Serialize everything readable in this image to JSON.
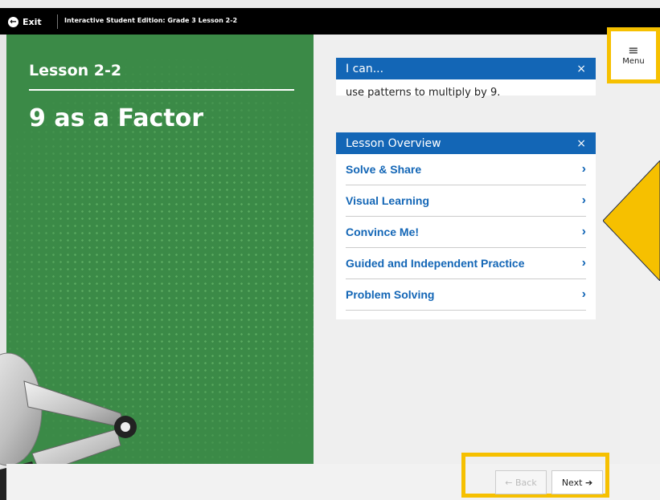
{
  "topbar": {
    "exit_label": "Exit",
    "breadcrumb": "Interactive Student Edition: Grade 3 Lesson 2-2"
  },
  "lesson": {
    "number": "Lesson 2-2",
    "title": "9 as a Factor"
  },
  "menu": {
    "label": "Menu"
  },
  "i_can": {
    "header": "I can...",
    "text": "use patterns to multiply by 9."
  },
  "overview": {
    "header": "Lesson Overview",
    "items": [
      {
        "label": "Solve & Share"
      },
      {
        "label": "Visual Learning"
      },
      {
        "label": "Convince Me!"
      },
      {
        "label": "Guided and Independent Practice"
      },
      {
        "label": "Problem Solving"
      }
    ]
  },
  "nav": {
    "back_label": "Back",
    "next_label": "Next"
  },
  "colors": {
    "green_panel": "#3b8a47",
    "header_blue": "#1366b6",
    "highlight_yellow": "#f6c000"
  },
  "icons": {
    "exit": "arrow-left-circle-icon",
    "menu": "hamburger-icon",
    "close": "close-icon",
    "chevron": "chevron-right-icon"
  }
}
